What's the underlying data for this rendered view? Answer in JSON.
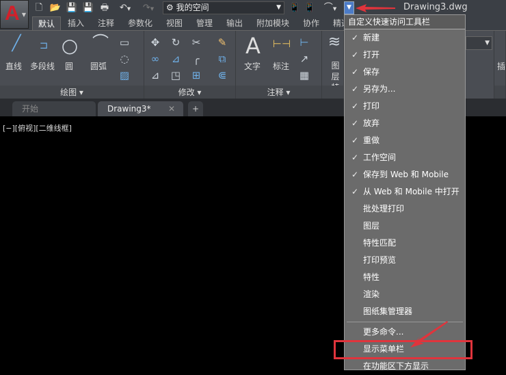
{
  "app": {
    "logo": "A",
    "filename": "Drawing3.dwg"
  },
  "quick_access": {
    "icons": [
      "new-icon",
      "open-icon",
      "save-icon",
      "save-as-icon",
      "print-icon",
      "undo-icon",
      "redo-icon"
    ],
    "workspace": "我的空间"
  },
  "ribbon_tabs": [
    "默认",
    "插入",
    "注释",
    "参数化",
    "视图",
    "管理",
    "输出",
    "附加模块",
    "协作",
    "精选"
  ],
  "panels": {
    "draw": {
      "title": "绘图",
      "tools": [
        "直线",
        "多段线",
        "圆",
        "圆弧"
      ]
    },
    "modify": {
      "title": "修改"
    },
    "annotate": {
      "title": "注释",
      "tools": [
        "文字",
        "标注"
      ]
    },
    "layers": {
      "tools": [
        "图层",
        "特性"
      ]
    },
    "insert": {
      "tool": "插"
    }
  },
  "doc_tabs": [
    "开始",
    "Drawing3*"
  ],
  "viewport_label": "[−][俯视][二维线框]",
  "menu": {
    "title": "自定义快速访问工具栏",
    "items": [
      {
        "label": "新建",
        "checked": true
      },
      {
        "label": "打开",
        "checked": true
      },
      {
        "label": "保存",
        "checked": true
      },
      {
        "label": "另存为...",
        "checked": true
      },
      {
        "label": "打印",
        "checked": true
      },
      {
        "label": "放弃",
        "checked": true
      },
      {
        "label": "重做",
        "checked": true
      },
      {
        "label": "工作空间",
        "checked": true
      },
      {
        "label": "保存到 Web 和 Mobile",
        "checked": true
      },
      {
        "label": "从 Web 和 Mobile 中打开",
        "checked": true
      },
      {
        "label": "批处理打印",
        "checked": false
      },
      {
        "label": "图层",
        "checked": false
      },
      {
        "label": "特性匹配",
        "checked": false
      },
      {
        "label": "打印预览",
        "checked": false
      },
      {
        "label": "特性",
        "checked": false
      },
      {
        "label": "渲染",
        "checked": false
      },
      {
        "label": "图纸集管理器",
        "checked": false
      }
    ],
    "extra": [
      "更多命令...",
      "显示菜单栏",
      "在功能区下方显示"
    ],
    "check_glyph": "✓"
  },
  "colors": {
    "highlight": "#e0343c",
    "accent": "#4c7cc8"
  }
}
